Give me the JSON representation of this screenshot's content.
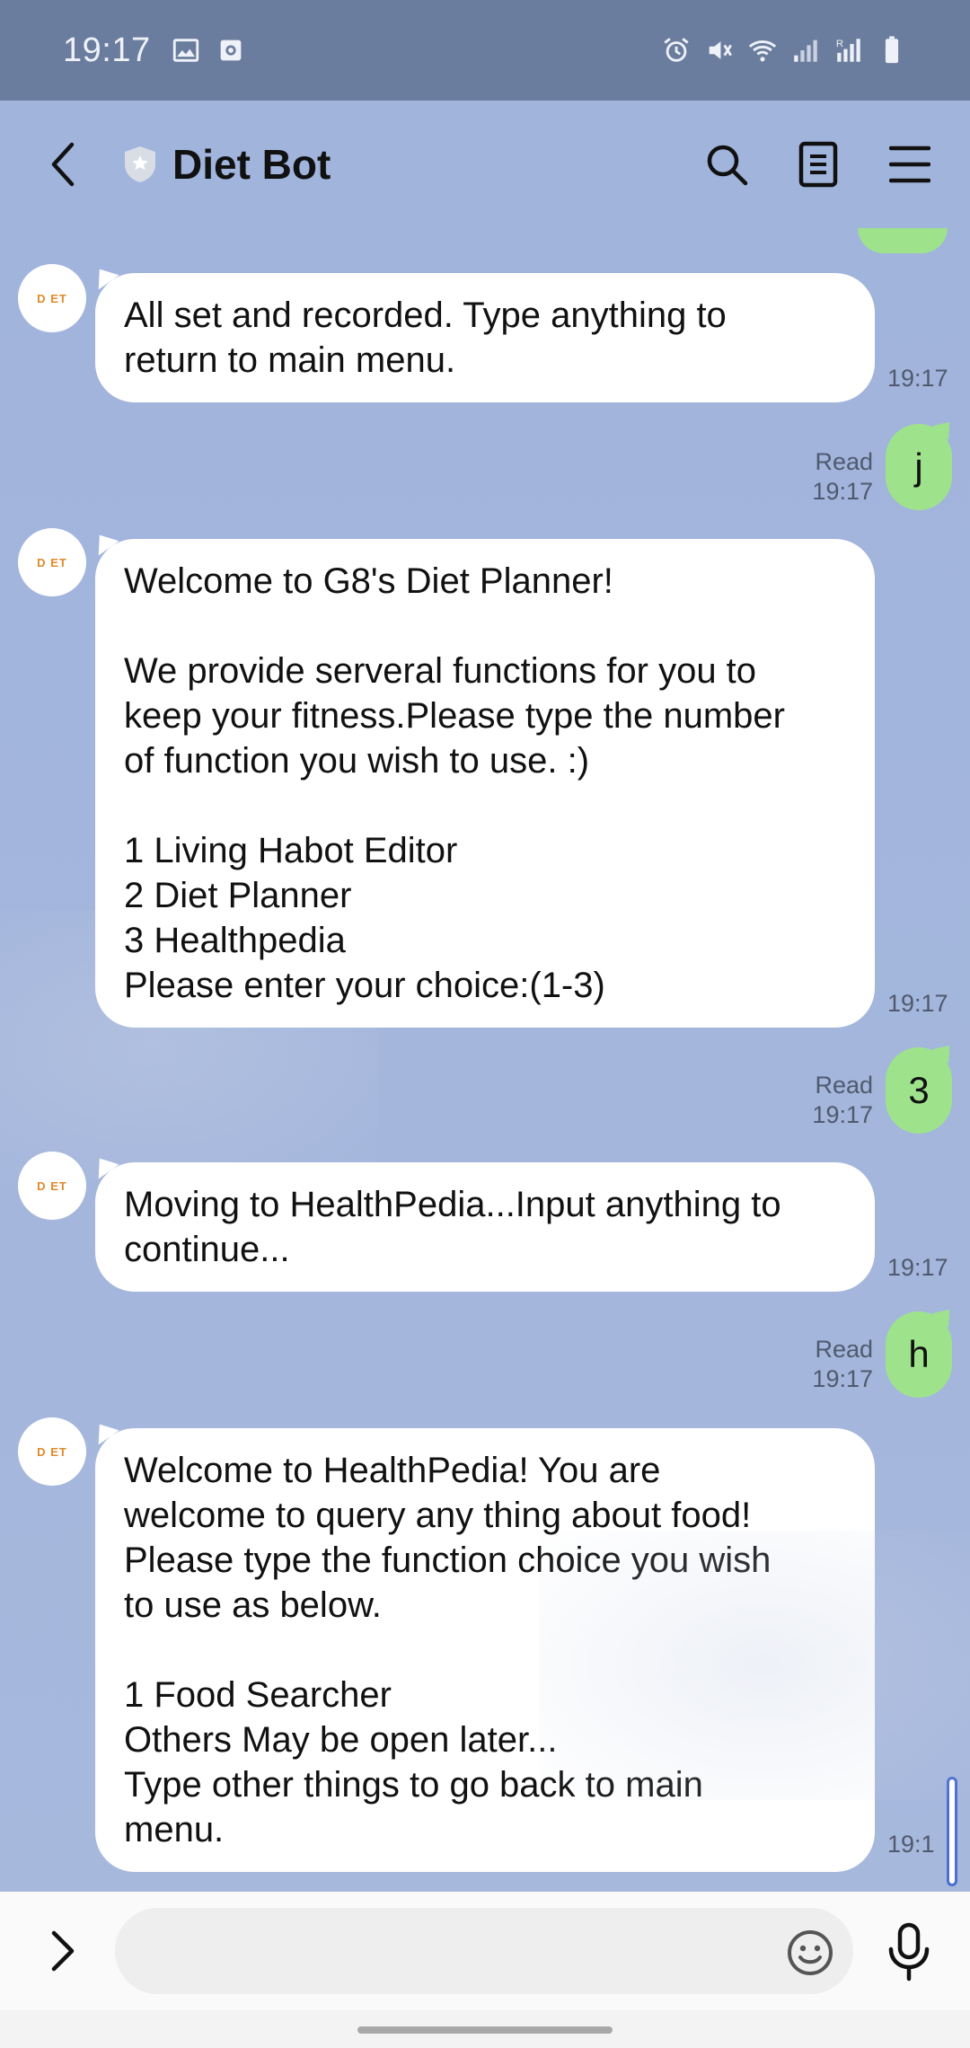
{
  "status_bar": {
    "time": "19:17",
    "left_icons": [
      "gallery-icon",
      "screen-record-icon"
    ],
    "right_icons": [
      "alarm-icon",
      "mute-icon",
      "wifi-icon",
      "signal-icon",
      "signal-roaming-icon",
      "battery-icon"
    ]
  },
  "header": {
    "title": "Diet Bot"
  },
  "messages": [
    {
      "direction": "in",
      "text": "All set and recorded. Type anything to\nreturn to main menu.",
      "time": "19:17"
    },
    {
      "direction": "out",
      "text": "j",
      "read": "Read",
      "time": "19:17"
    },
    {
      "direction": "in",
      "text": "Welcome to G8's Diet Planner!\n\nWe provide serveral functions for you to\nkeep your fitness.Please type the number\nof function you wish to use. :)\n\n1 Living Habot Editor\n2 Diet Planner\n3 Healthpedia\nPlease enter your choice:(1-3)",
      "time": "19:17"
    },
    {
      "direction": "out",
      "text": "3",
      "read": "Read",
      "time": "19:17"
    },
    {
      "direction": "in",
      "text": "Moving to HealthPedia...Input anything to\ncontinue...",
      "time": "19:17"
    },
    {
      "direction": "out",
      "text": "h",
      "read": "Read",
      "time": "19:17"
    },
    {
      "direction": "in",
      "text": "Welcome to HealthPedia! You are\nwelcome to query any thing about food!\nPlease type the function choice you wish\nto use as below.\n\n1 Food Searcher\nOthers May be open later...\nType other things to go back to main\nmenu.",
      "time": "19:1"
    }
  ],
  "avatar_logo": "D ET",
  "input": {
    "value": "",
    "placeholder": ""
  },
  "colors": {
    "chat_background": "#a5b6da",
    "outgoing_bubble": "#9ee38c",
    "incoming_bubble": "#ffffff",
    "status_bar": "#6b7d9e"
  }
}
